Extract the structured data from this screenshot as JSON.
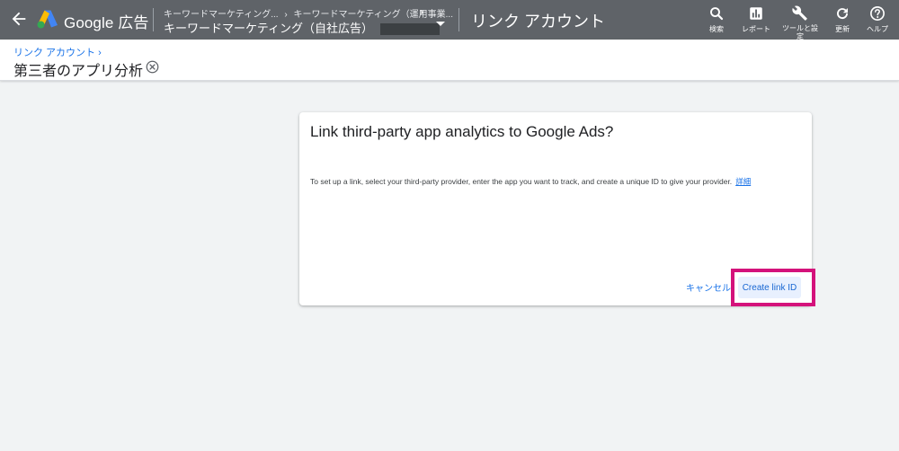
{
  "header": {
    "brand": "Google 広告",
    "breadcrumb": [
      "キーワードマーケティング...",
      "キーワードマーケティング（運用事業..."
    ],
    "account_name": "キーワードマーケティング（自社広告）",
    "page_title": "リンク アカウント"
  },
  "tools": [
    {
      "label": "検索",
      "icon": "search-icon"
    },
    {
      "label": "レポート",
      "icon": "reports-icon"
    },
    {
      "label": "ツールと設定",
      "icon": "wrench-icon"
    },
    {
      "label": "更新",
      "icon": "refresh-icon"
    },
    {
      "label": "ヘルプ",
      "icon": "help-icon"
    }
  ],
  "subheader": {
    "crumb": "リンク アカウント",
    "title": "第三者のアプリ分析"
  },
  "card": {
    "title": "Link third-party app analytics to Google Ads?",
    "description": "To set up a link, select your third-party provider, enter the app you want to track, and create a unique ID to give your provider.",
    "learn_more": "詳細",
    "cancel_label": "キャンセル",
    "create_label": "Create link ID"
  },
  "colors": {
    "topbar": "#5f6368",
    "accent": "#1a73e8",
    "highlight": "#d4127b"
  }
}
